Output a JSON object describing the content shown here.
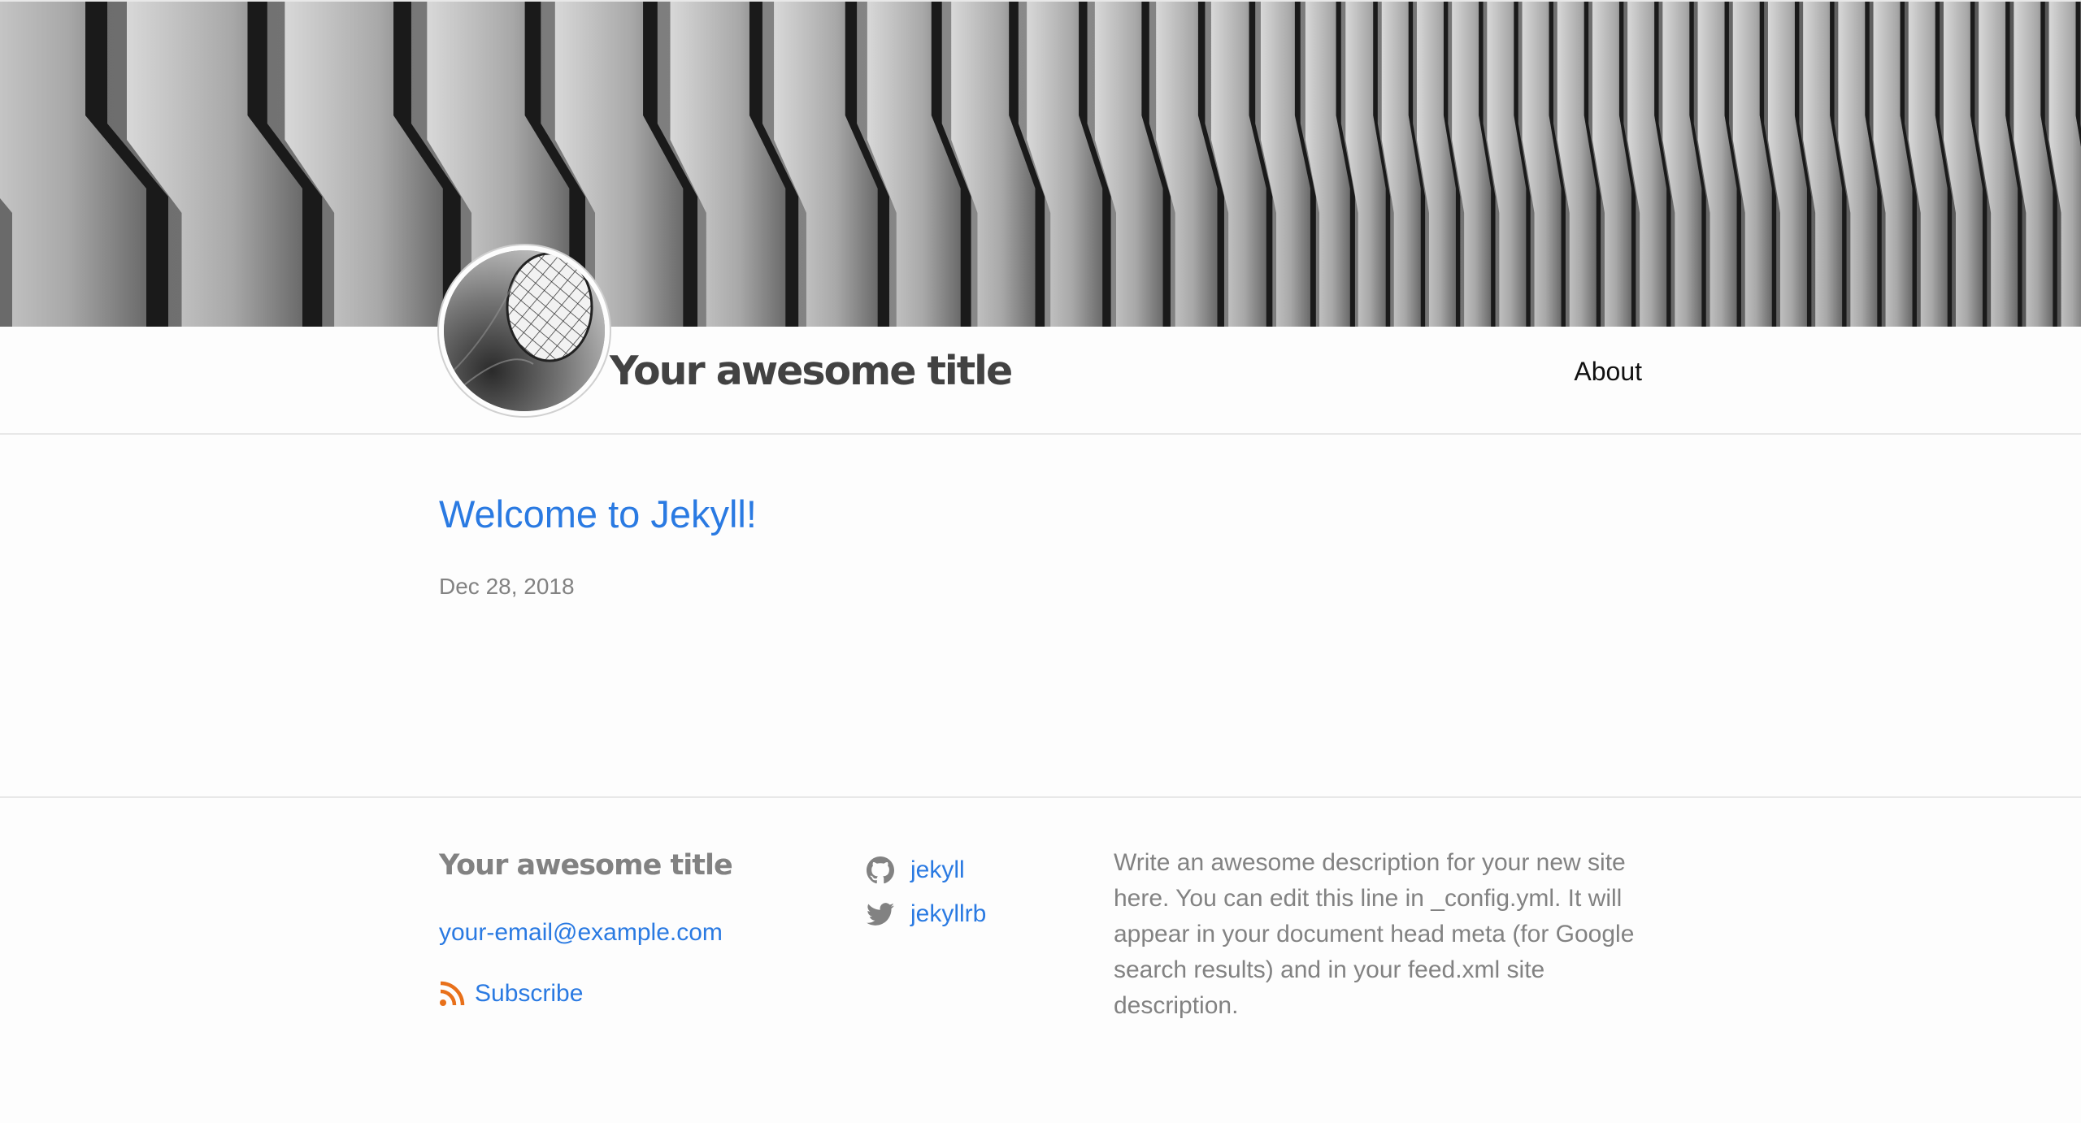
{
  "header": {
    "site_title": "Your awesome title",
    "nav": [
      {
        "label": "About"
      }
    ]
  },
  "main": {
    "posts": [
      {
        "title": "Welcome to Jekyll!",
        "date": "Dec 28, 2018"
      }
    ]
  },
  "footer": {
    "title": "Your awesome title",
    "email": "your-email@example.com",
    "subscribe_label": "Subscribe",
    "social": [
      {
        "icon": "github-icon",
        "label": "jekyll"
      },
      {
        "icon": "twitter-icon",
        "label": "jekyllrb"
      }
    ],
    "description": "Write an awesome description for your new site here. You can edit this line in _config.yml. It will appear in your document head meta (for Google search results) and in your feed.xml site description."
  },
  "colors": {
    "link": "#2a7ae2",
    "text": "#111111",
    "muted": "#828282",
    "rss": "#e8701a",
    "background": "#fdfdfd"
  }
}
